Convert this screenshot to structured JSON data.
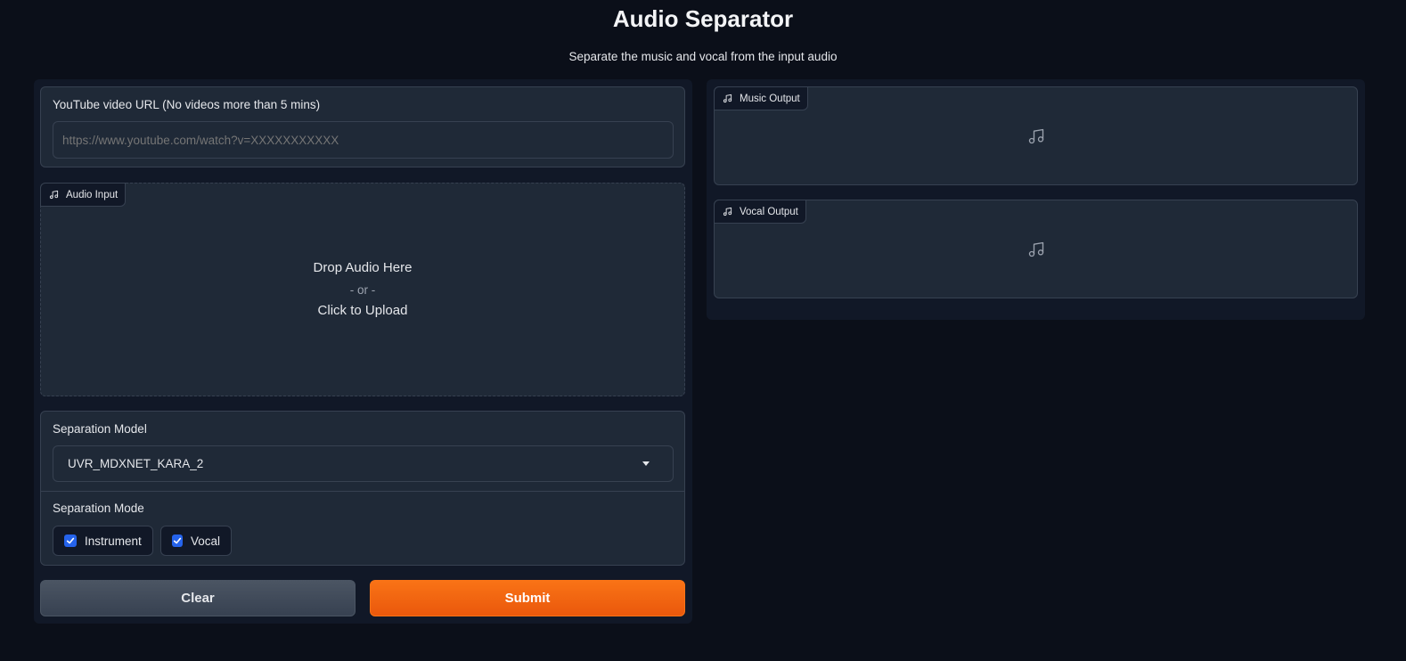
{
  "header": {
    "title": "Audio Separator",
    "subtitle": "Separate the music and vocal from the input audio"
  },
  "youtube": {
    "label": "YouTube video URL (No videos more than 5 mins)",
    "placeholder": "https://www.youtube.com/watch?v=XXXXXXXXXXX",
    "value": ""
  },
  "audio_input": {
    "label": "Audio Input",
    "icon": "music-note-icon",
    "drop_text": "Drop Audio Here",
    "or_text": "- or -",
    "click_text": "Click to Upload"
  },
  "model": {
    "label": "Separation Model",
    "selected": "UVR_MDXNET_KARA_2"
  },
  "mode": {
    "label": "Separation Mode",
    "options": [
      {
        "label": "Instrument",
        "checked": true
      },
      {
        "label": "Vocal",
        "checked": true
      }
    ]
  },
  "buttons": {
    "clear": "Clear",
    "submit": "Submit"
  },
  "outputs": {
    "music_label": "Music Output",
    "vocal_label": "Vocal Output",
    "icon": "music-note-icon"
  },
  "colors": {
    "background": "#0b0f19",
    "panel": "#1f2937",
    "accent": "#f97316",
    "checkbox": "#2563eb"
  }
}
